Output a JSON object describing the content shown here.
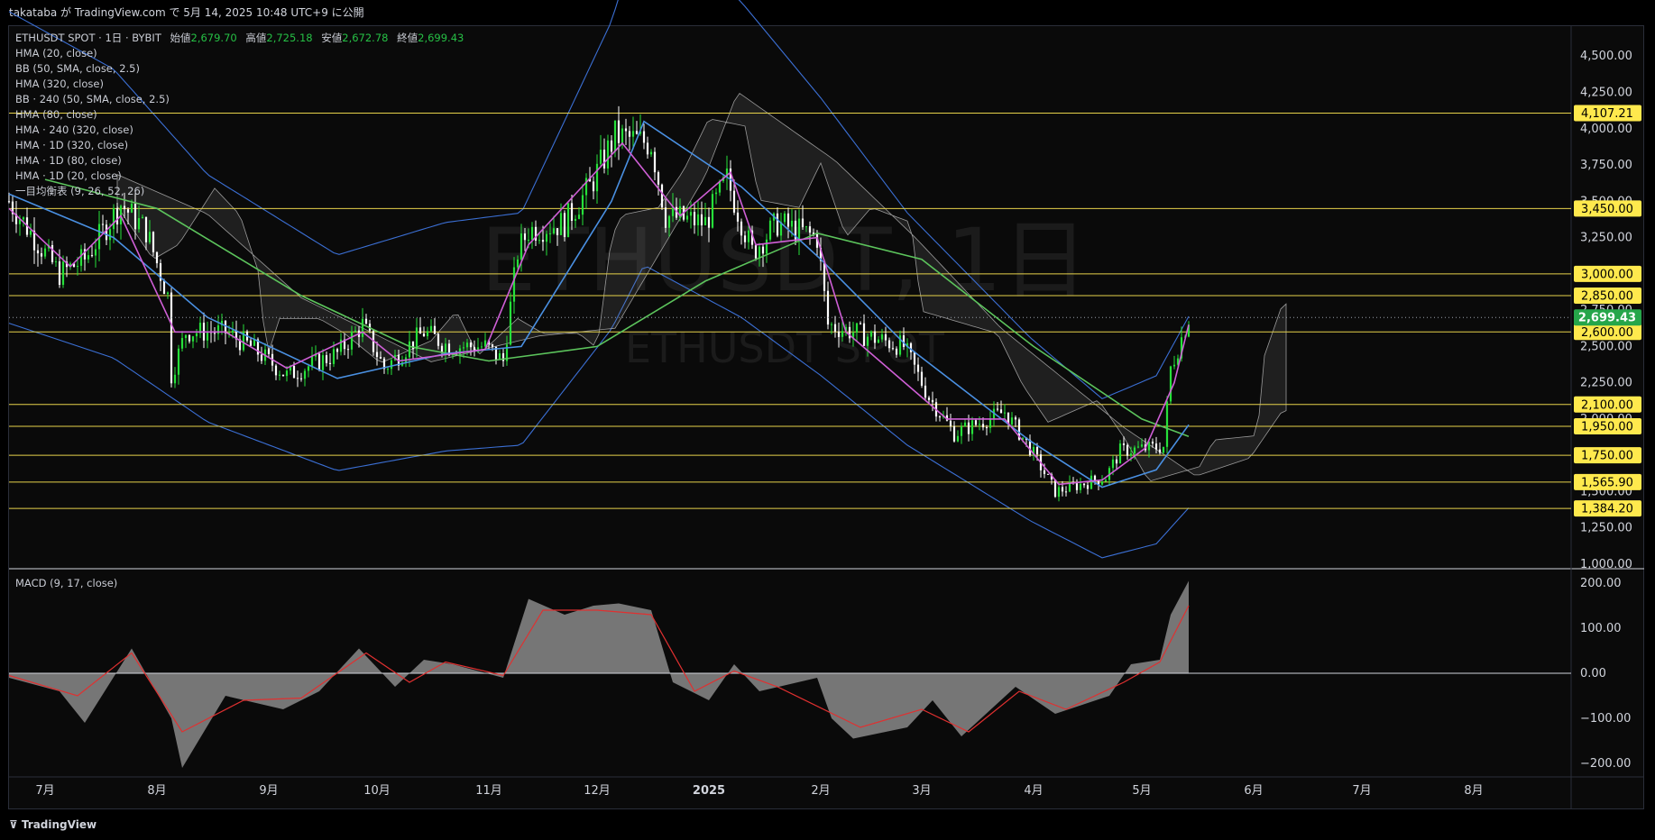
{
  "header": {
    "publish_text": "takataba が TradingView.com で 5月 14, 2025 10:48 UTC+9 に公開"
  },
  "legend": {
    "symbol": "ETHUSDT SPOT · 1日 · BYBIT",
    "open_label": "始値",
    "open": "2,679.70",
    "high_label": "高値",
    "high": "2,725.18",
    "low_label": "安値",
    "low": "2,672.78",
    "close_label": "終値",
    "close": "2,699.43",
    "indicators": [
      "HMA (20, close)",
      "BB (50, SMA, close, 2.5)",
      "HMA (320, close)",
      "BB · 240 (50, SMA, close, 2.5)",
      "HMA (80, close)",
      "HMA · 240 (320, close)",
      "HMA · 1D (320, close)",
      "HMA · 1D (80, close)",
      "HMA · 1D (20, close)",
      "一目均衡表 (9, 26, 52, 26)"
    ]
  },
  "watermark": {
    "big": "ETHUSDT, 1日",
    "small": "ETHUSDT SPOT"
  },
  "macd_legend": "MACD (9, 17, close)",
  "footer": {
    "brand": "TradingView"
  },
  "colors": {
    "background": "#0a0a0a",
    "candle_up": "#26e03a",
    "candle_down": "#ffffff",
    "hma20": "#cf5fd6",
    "hma80": "#4a90e2",
    "hma320": "#5cc45c",
    "bb": "#3b6fd4",
    "hline": "#e6d24a",
    "current_price_bg": "#26a64a",
    "level_bg": "#ffe94d",
    "macd_hist": "#8a8a8a",
    "macd_signal": "#e03030"
  },
  "chart_data": [
    {
      "type": "candlestick",
      "title": "ETHUSDT SPOT · 1日 · BYBIT",
      "y_axis": {
        "ticks": [
          1000,
          1250,
          1500,
          1750,
          2000,
          2250,
          2500,
          2750,
          3000,
          3250,
          3500,
          3750,
          4000,
          4250,
          4500
        ],
        "tick_labels": [
          "1,000.00",
          "1,250.00",
          "1,500.00",
          "1,750.00",
          "2,000.00",
          "2,250.00",
          "2,500.00",
          "2,750.00",
          "3,000.00",
          "3,250.00",
          "3,500.00",
          "3,750.00",
          "4,000.00",
          "4,250.00",
          "4,500.00"
        ],
        "ylim": [
          975,
          4700
        ]
      },
      "x_axis": {
        "labels": [
          "7月",
          "8月",
          "9月",
          "10月",
          "11月",
          "12月",
          "2025",
          "2月",
          "3月",
          "4月",
          "5月",
          "6月",
          "7月",
          "8月"
        ],
        "dates": [
          "2024-07-01",
          "2024-08-01",
          "2024-09-01",
          "2024-10-01",
          "2024-11-01",
          "2024-12-01",
          "2025-01-01",
          "2025-02-01",
          "2025-03-01",
          "2025-04-01",
          "2025-05-01",
          "2025-06-01",
          "2025-07-01",
          "2025-08-01"
        ]
      },
      "horizontal_levels": [
        {
          "value": 4107.21,
          "label": "4,107.21"
        },
        {
          "value": 3450.0,
          "label": "3,450.00"
        },
        {
          "value": 3000.0,
          "label": "3,000.00"
        },
        {
          "value": 2850.0,
          "label": "2,850.00"
        },
        {
          "value": 2600.0,
          "label": "2,600.00"
        },
        {
          "value": 2100.0,
          "label": "2,100.00"
        },
        {
          "value": 1950.0,
          "label": "1,950.00"
        },
        {
          "value": 1750.0,
          "label": "1,750.00"
        },
        {
          "value": 1565.9,
          "label": "1,565.90"
        },
        {
          "value": 1384.2,
          "label": "1,384.20"
        }
      ],
      "current_price": {
        "value": 2699.43,
        "label": "2,699.43"
      },
      "close_path": [
        [
          "2024-06-21",
          3500
        ],
        [
          "2024-07-05",
          3000
        ],
        [
          "2024-07-12",
          3100
        ],
        [
          "2024-07-22",
          3480
        ],
        [
          "2024-07-29",
          3300
        ],
        [
          "2024-08-04",
          2850
        ],
        [
          "2024-08-05",
          2300
        ],
        [
          "2024-08-09",
          2600
        ],
        [
          "2024-08-20",
          2600
        ],
        [
          "2024-08-27",
          2500
        ],
        [
          "2024-09-06",
          2300
        ],
        [
          "2024-09-20",
          2450
        ],
        [
          "2024-09-27",
          2650
        ],
        [
          "2024-10-03",
          2350
        ],
        [
          "2024-10-14",
          2600
        ],
        [
          "2024-10-21",
          2500
        ],
        [
          "2024-10-31",
          2500
        ],
        [
          "2024-11-05",
          2400
        ],
        [
          "2024-11-09",
          3150
        ],
        [
          "2024-11-12",
          3300
        ],
        [
          "2024-11-22",
          3350
        ],
        [
          "2024-11-29",
          3600
        ],
        [
          "2024-12-06",
          3950
        ],
        [
          "2024-12-16",
          3900
        ],
        [
          "2024-12-20",
          3400
        ],
        [
          "2024-12-31",
          3350
        ],
        [
          "2025-01-06",
          3650
        ],
        [
          "2025-01-13",
          3150
        ],
        [
          "2025-01-20",
          3350
        ],
        [
          "2025-01-31",
          3250
        ],
        [
          "2025-02-03",
          2650
        ],
        [
          "2025-02-10",
          2600
        ],
        [
          "2025-02-24",
          2500
        ],
        [
          "2025-03-03",
          2150
        ],
        [
          "2025-03-10",
          1900
        ],
        [
          "2025-03-24",
          2050
        ],
        [
          "2025-03-31",
          1800
        ],
        [
          "2025-04-07",
          1500
        ],
        [
          "2025-04-21",
          1600
        ],
        [
          "2025-04-25",
          1780
        ],
        [
          "2025-05-07",
          1810
        ],
        [
          "2025-05-09",
          2350
        ],
        [
          "2025-05-14",
          2699
        ]
      ],
      "hma20_path": [
        [
          "2024-06-21",
          3450
        ],
        [
          "2024-07-08",
          3050
        ],
        [
          "2024-07-22",
          3400
        ],
        [
          "2024-08-06",
          2600
        ],
        [
          "2024-08-20",
          2600
        ],
        [
          "2024-09-06",
          2350
        ],
        [
          "2024-09-27",
          2600
        ],
        [
          "2024-10-07",
          2400
        ],
        [
          "2024-10-31",
          2480
        ],
        [
          "2024-11-12",
          3200
        ],
        [
          "2024-12-08",
          3900
        ],
        [
          "2024-12-24",
          3400
        ],
        [
          "2025-01-07",
          3700
        ],
        [
          "2025-01-14",
          3200
        ],
        [
          "2025-01-31",
          3250
        ],
        [
          "2025-02-08",
          2600
        ],
        [
          "2025-03-08",
          2000
        ],
        [
          "2025-03-24",
          2000
        ],
        [
          "2025-04-08",
          1550
        ],
        [
          "2025-04-20",
          1580
        ],
        [
          "2025-05-02",
          1800
        ],
        [
          "2025-05-10",
          2250
        ],
        [
          "2025-05-14",
          2650
        ]
      ],
      "hma80_path": [
        [
          "2024-06-21",
          3550
        ],
        [
          "2024-07-20",
          3250
        ],
        [
          "2024-08-15",
          2700
        ],
        [
          "2024-09-20",
          2280
        ],
        [
          "2024-10-20",
          2450
        ],
        [
          "2024-11-10",
          2500
        ],
        [
          "2024-12-05",
          3500
        ],
        [
          "2024-12-14",
          4050
        ],
        [
          "2025-01-10",
          3600
        ],
        [
          "2025-02-01",
          3100
        ],
        [
          "2025-02-25",
          2500
        ],
        [
          "2025-03-31",
          1850
        ],
        [
          "2025-04-20",
          1530
        ],
        [
          "2025-05-05",
          1650
        ],
        [
          "2025-05-14",
          1960
        ]
      ],
      "hma320_path": [
        [
          "2024-07-01",
          3650
        ],
        [
          "2024-08-01",
          3450
        ],
        [
          "2024-09-10",
          2850
        ],
        [
          "2024-10-10",
          2500
        ],
        [
          "2024-11-01",
          2400
        ],
        [
          "2024-12-01",
          2500
        ],
        [
          "2024-12-31",
          2950
        ],
        [
          "2025-01-31",
          3280
        ],
        [
          "2025-03-01",
          3100
        ],
        [
          "2025-04-01",
          2500
        ],
        [
          "2025-05-01",
          2000
        ],
        [
          "2025-05-14",
          1880
        ]
      ]
    },
    {
      "type": "macd",
      "title": "MACD (9, 17, close)",
      "y_axis": {
        "ticks": [
          -200,
          -100,
          0,
          100,
          200
        ],
        "tick_labels": [
          "−200.00",
          "−100.00",
          "0.00",
          "100.00",
          "200.00"
        ],
        "ylim": [
          -230,
          230
        ]
      },
      "macd_path": [
        [
          "2024-06-21",
          -10
        ],
        [
          "2024-07-05",
          -40
        ],
        [
          "2024-07-12",
          -110
        ],
        [
          "2024-07-25",
          55
        ],
        [
          "2024-08-05",
          -100
        ],
        [
          "2024-08-08",
          -210
        ],
        [
          "2024-08-20",
          -50
        ],
        [
          "2024-09-05",
          -80
        ],
        [
          "2024-09-15",
          -40
        ],
        [
          "2024-09-26",
          55
        ],
        [
          "2024-10-06",
          -30
        ],
        [
          "2024-10-14",
          30
        ],
        [
          "2024-10-22",
          20
        ],
        [
          "2024-11-05",
          -10
        ],
        [
          "2024-11-12",
          165
        ],
        [
          "2024-11-22",
          130
        ],
        [
          "2024-11-30",
          150
        ],
        [
          "2024-12-07",
          155
        ],
        [
          "2024-12-16",
          140
        ],
        [
          "2024-12-22",
          -20
        ],
        [
          "2025-01-01",
          -60
        ],
        [
          "2025-01-08",
          20
        ],
        [
          "2025-01-15",
          -40
        ],
        [
          "2025-01-31",
          -10
        ],
        [
          "2025-02-04",
          -100
        ],
        [
          "2025-02-10",
          -145
        ],
        [
          "2025-02-25",
          -120
        ],
        [
          "2025-03-04",
          -60
        ],
        [
          "2025-03-12",
          -140
        ],
        [
          "2025-03-27",
          -30
        ],
        [
          "2025-04-07",
          -90
        ],
        [
          "2025-04-22",
          -50
        ],
        [
          "2025-04-28",
          20
        ],
        [
          "2025-05-06",
          30
        ],
        [
          "2025-05-09",
          130
        ],
        [
          "2025-05-14",
          205
        ]
      ],
      "signal_path": [
        [
          "2024-06-21",
          -5
        ],
        [
          "2024-07-10",
          -50
        ],
        [
          "2024-07-25",
          45
        ],
        [
          "2024-08-08",
          -130
        ],
        [
          "2024-08-25",
          -60
        ],
        [
          "2024-09-10",
          -55
        ],
        [
          "2024-09-28",
          45
        ],
        [
          "2024-10-10",
          -20
        ],
        [
          "2024-10-20",
          25
        ],
        [
          "2024-11-05",
          -5
        ],
        [
          "2024-11-16",
          140
        ],
        [
          "2024-12-01",
          140
        ],
        [
          "2024-12-16",
          130
        ],
        [
          "2024-12-28",
          -40
        ],
        [
          "2025-01-08",
          5
        ],
        [
          "2025-01-20",
          -30
        ],
        [
          "2025-02-12",
          -120
        ],
        [
          "2025-03-01",
          -80
        ],
        [
          "2025-03-14",
          -130
        ],
        [
          "2025-03-28",
          -40
        ],
        [
          "2025-04-10",
          -80
        ],
        [
          "2025-04-26",
          -20
        ],
        [
          "2025-05-06",
          25
        ],
        [
          "2025-05-14",
          150
        ]
      ]
    }
  ]
}
